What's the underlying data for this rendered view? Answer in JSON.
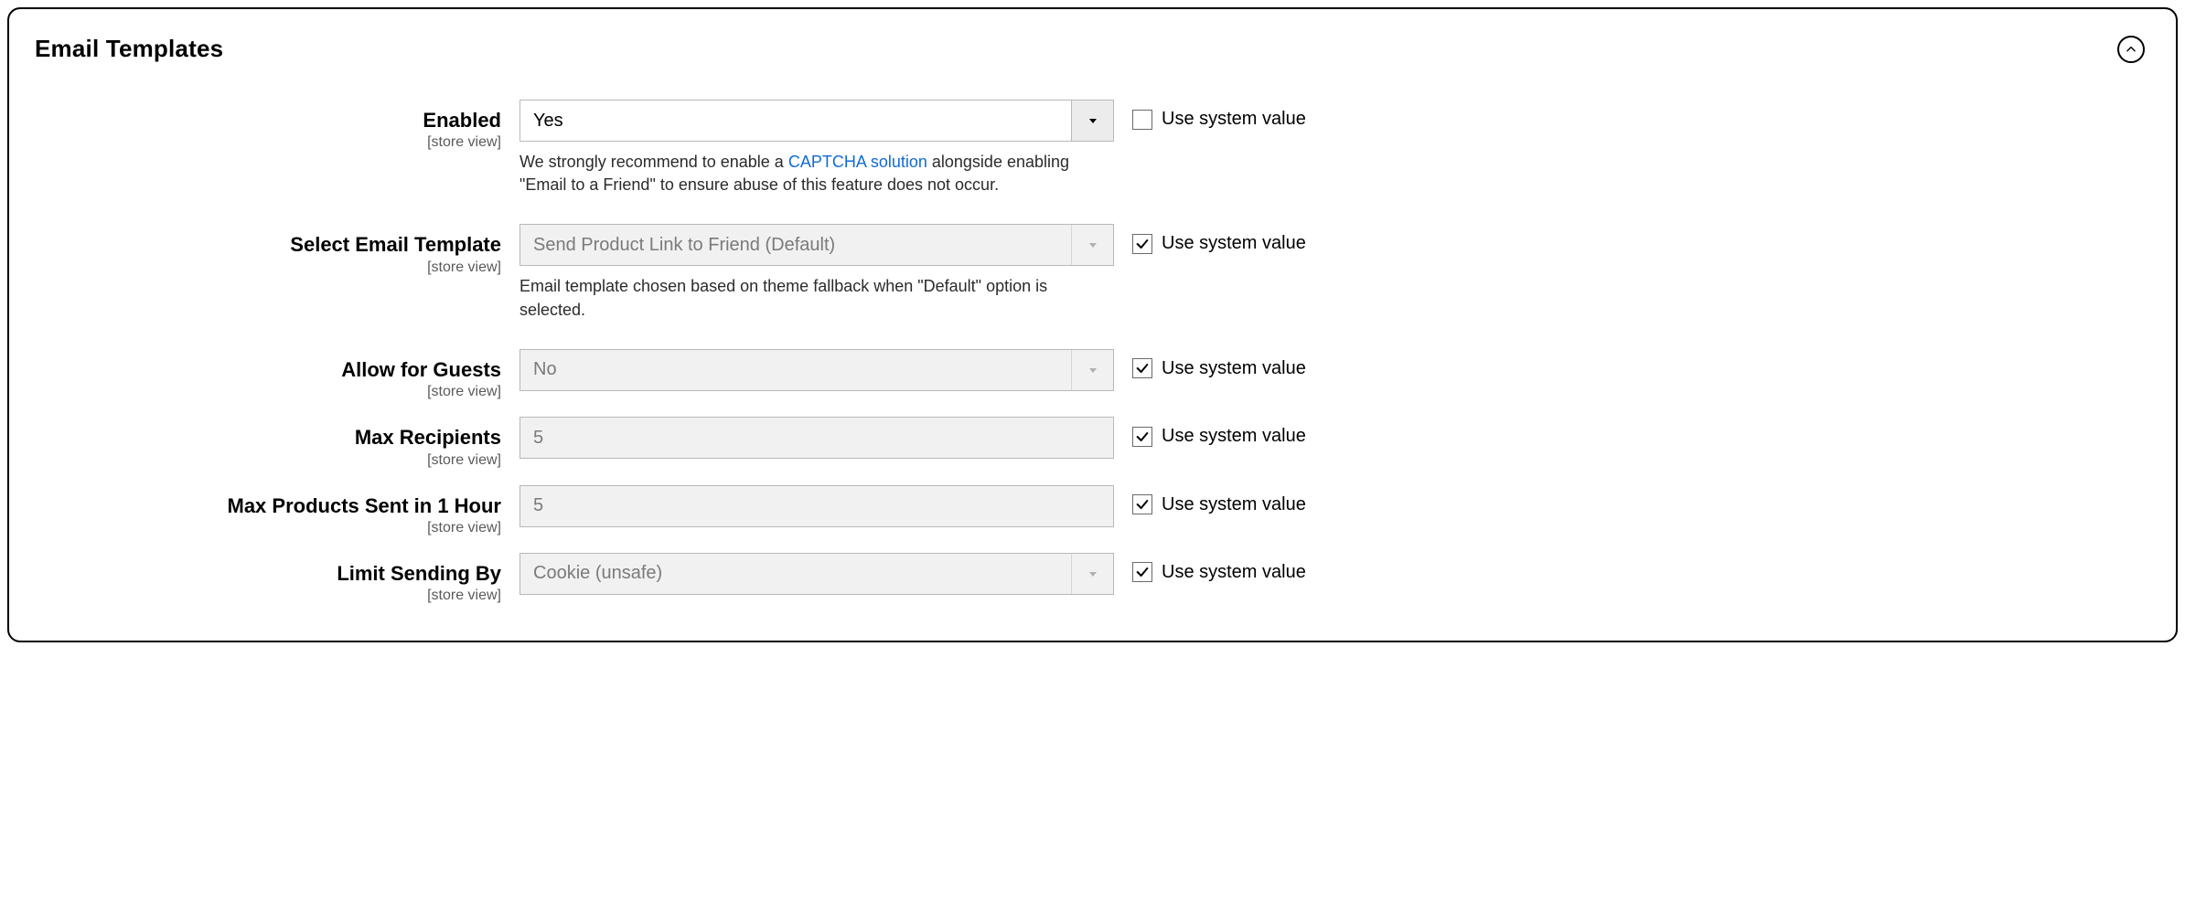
{
  "panel": {
    "title": "Email Templates"
  },
  "common": {
    "scope": "[store view]",
    "use_system_label": "Use system value"
  },
  "fields": {
    "enabled": {
      "label": "Enabled",
      "value": "Yes",
      "use_system_checked": false,
      "note_pre": "We strongly recommend to enable a ",
      "note_link": "CAPTCHA solution",
      "note_post": " alongside enabling \"Email to a Friend\" to ensure abuse of this feature does not occur."
    },
    "select_template": {
      "label": "Select Email Template",
      "value": "Send Product Link to Friend (Default)",
      "use_system_checked": true,
      "note": "Email template chosen based on theme fallback when \"Default\" option is selected."
    },
    "allow_guests": {
      "label": "Allow for Guests",
      "value": "No",
      "use_system_checked": true
    },
    "max_recipients": {
      "label": "Max Recipients",
      "value": "5",
      "use_system_checked": true
    },
    "max_products": {
      "label": "Max Products Sent in 1 Hour",
      "value": "5",
      "use_system_checked": true
    },
    "limit_sending": {
      "label": "Limit Sending By",
      "value": "Cookie (unsafe)",
      "use_system_checked": true
    }
  }
}
